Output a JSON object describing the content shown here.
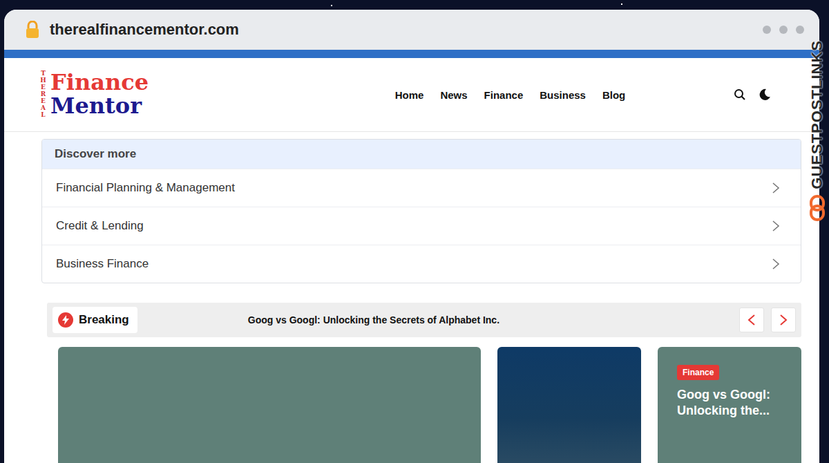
{
  "browser": {
    "url": "therealfinancementor.com"
  },
  "logo": {
    "tagline": "THE REAL",
    "line1": "Finance",
    "line2": "Mentor"
  },
  "nav": [
    {
      "label": "Home"
    },
    {
      "label": "News"
    },
    {
      "label": "Finance"
    },
    {
      "label": "Business"
    },
    {
      "label": "Blog"
    }
  ],
  "discover": {
    "title": "Discover more",
    "items": [
      "Financial Planning & Management",
      "Credit & Lending",
      "Business Finance"
    ]
  },
  "breaking": {
    "label": "Breaking",
    "headline": "Goog vs Googl: Unlocking the Secrets of Alphabet Inc."
  },
  "cards": [
    {
      "kind": "plain"
    },
    {
      "kind": "photo"
    },
    {
      "kind": "post",
      "tag": "Finance",
      "title": "Goog vs Googl: Unlocking the..."
    }
  ],
  "watermark": "GUESTPOSTLINKS"
}
